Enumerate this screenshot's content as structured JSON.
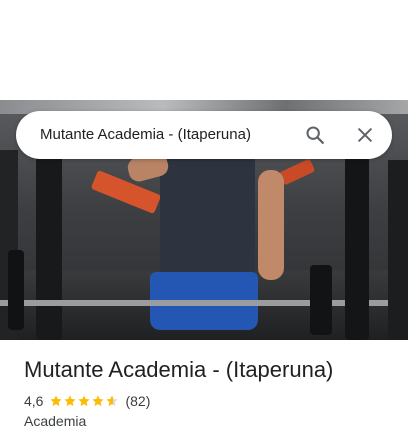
{
  "search": {
    "query": "Mutante Academia - (Itaperuna)",
    "search_icon": "search-icon",
    "close_icon": "close-icon"
  },
  "place": {
    "name": "Mutante Academia - (Itaperuna)",
    "rating": "4,6",
    "rating_numeric": 4.6,
    "stars_max": 5,
    "review_count": "(82)",
    "category": "Academia"
  },
  "colors": {
    "star": "#fbbc04",
    "star_empty": "#dadce0",
    "text_primary": "#202124",
    "text_secondary": "#3c4043",
    "icon": "#5f6368"
  }
}
